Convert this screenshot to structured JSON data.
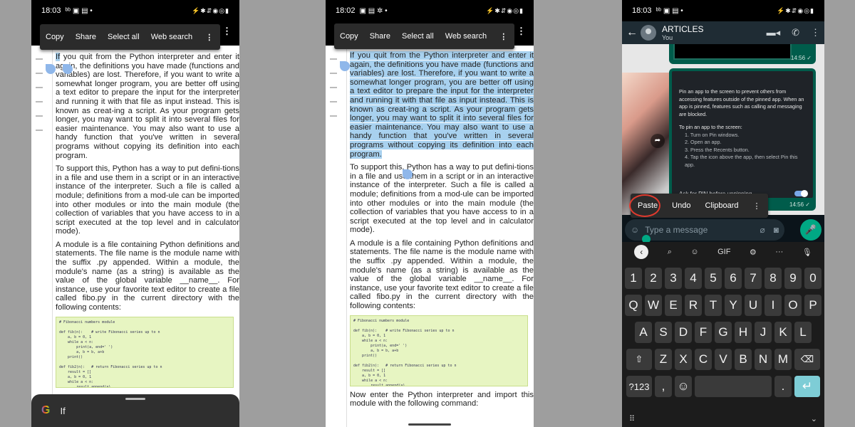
{
  "phone1": {
    "time": "18:03",
    "status_icons": "ᵇᵇ ▣ ▤ •",
    "status_right": "⚡✱⇵◉◎▮",
    "menu": {
      "copy": "Copy",
      "share": "Share",
      "select_all": "Select all",
      "web_search": "Web search",
      "more": "⋮"
    },
    "top_more": "⋮",
    "search_query": "If",
    "google_logo": "G"
  },
  "phone2": {
    "time": "18:02",
    "status_icons": "▣ ▤ ✲ •",
    "status_right": "⚡✱⇵◉◎▮",
    "menu": {
      "copy": "Copy",
      "share": "Share",
      "select_all": "Select all",
      "web_search": "Web search",
      "more": "⋮"
    },
    "top_more": "⋮"
  },
  "doc": {
    "p1_a": "If",
    "p1_b": " you quit from the Python interpreter and enter it again, the definitions you have made (functions and variables) are lost. Therefore, if you want to write a somewhat longer program, you are better off using a text editor to prepare the input for the interpreter and running it with that file as input instead. This is known as creat-ing a script. As your program gets longer, you may want to split it into several files for easier maintenance. You may also want to use a handy function that you've written in several programs without copying its definition into each program.",
    "p2": "To support this, Python has a way to put defini-tions in a file and use them in a script or in an interactive instance of the interpreter. Such a file is called a module; definitions from a mod-ule can be imported into other modules or into the main module (the collection of variables that you have access to in a script executed at the top level and in calculator mode).",
    "p3": "A module is a file containing Python definitions and statements. The file name is the module name with the suffix .py appended. Within a module, the module's name (as a string) is available as the value of the global variable __name__. For instance, use your favorite text editor to create a file called fibo.py in the current directory with the following contents:",
    "code": "# Fibonacci numbers module\n\ndef fib(n):    # write Fibonacci series up to n\n    a, b = 0, 1\n    while a < n:\n        print(a, end=' ')\n        a, b = b, a+b\n    print()\n\ndef fib2(n):   # return Fibonacci series up to n\n    result = []\n    a, b = 0, 1\n    while a < n:\n        result.append(a)\n        a, b = b, a+b\n    return result",
    "p4": "Now enter the Python interpreter and import this module with the following command:"
  },
  "phone3": {
    "time": "18:03",
    "status_icons": "ᵇᵇ ▣ ▤ •",
    "status_right": "⚡✱⇵◉◎▮",
    "chat_title": "ARTICLES",
    "chat_subtitle": "You",
    "back": "←",
    "video": "▬◂",
    "call": "✆",
    "more": "⋮",
    "time_msg1": "14:56 ✓",
    "time_msg2": "14:56 ✓",
    "share_glyph": "➦",
    "shot_intro": "Pin an app to the screen to prevent others from accessing features outside of the pinned app. When an app is pinned, features such as calling and messaging are blocked.",
    "shot_heading": "To pin an app to the screen:",
    "shot_steps": [
      "1. Turn on Pin windows.",
      "2. Open an app.",
      "3. Press the Recents button.",
      "4. Tap the icon above the app, then select Pin this app."
    ],
    "shot_pin_row": "Ask for PIN before unpinning",
    "paste_menu": {
      "paste": "Paste",
      "undo": "Undo",
      "clipboard": "Clipboard",
      "more": "⋮"
    },
    "input_placeholder": "Type a message",
    "emoji": "☺",
    "attach": "⌀",
    "camera": "◙",
    "mic": "🎤",
    "kb_toolbar": {
      "back": "‹",
      "search": "⌕",
      "sticker": "☺",
      "gif": "GIF",
      "settings": "⚙",
      "more": "···",
      "mic": "🎙"
    },
    "keys_row1": [
      "1",
      "2",
      "3",
      "4",
      "5",
      "6",
      "7",
      "8",
      "9",
      "0"
    ],
    "keys_row2": [
      "Q",
      "W",
      "E",
      "R",
      "T",
      "Y",
      "U",
      "I",
      "O",
      "P"
    ],
    "keys_row3": [
      "A",
      "S",
      "D",
      "F",
      "G",
      "H",
      "J",
      "K",
      "L"
    ],
    "keys_row4": [
      "Z",
      "X",
      "C",
      "V",
      "B",
      "N",
      "M"
    ],
    "key_shift": "⇧",
    "key_backspace": "⌫",
    "key_symbols": "?123",
    "key_comma": ",",
    "key_emoji": "☺",
    "key_space": "",
    "key_period": ".",
    "key_enter": "↵",
    "kb_grid": "⠿",
    "kb_hide": "⌄"
  }
}
